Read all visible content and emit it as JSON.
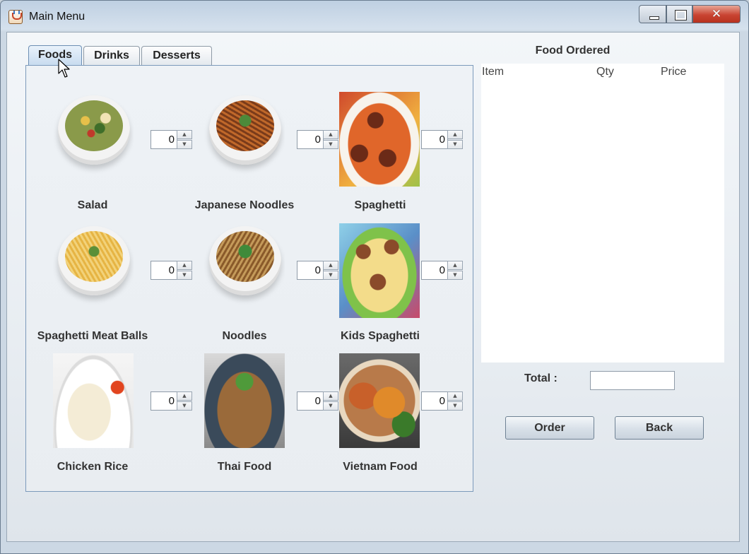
{
  "window": {
    "title": "Main Menu",
    "close_glyph": "✕"
  },
  "tabs": [
    {
      "label": "Foods",
      "active": true
    },
    {
      "label": "Drinks",
      "active": false
    },
    {
      "label": "Desserts",
      "active": false
    }
  ],
  "foods": [
    {
      "name": "Salad",
      "qty": "0",
      "icon": "salad-bowl-image"
    },
    {
      "name": "Japanese Noodles",
      "qty": "0",
      "icon": "japanese-noodles-bowl-image"
    },
    {
      "name": "Spaghetti",
      "qty": "0",
      "icon": "spaghetti-plate-photo"
    },
    {
      "name": "Spaghetti Meat Balls",
      "qty": "0",
      "icon": "spaghetti-meatballs-bowl-image"
    },
    {
      "name": "Noodles",
      "qty": "0",
      "icon": "noodles-bowl-image"
    },
    {
      "name": "Kids Spaghetti",
      "qty": "0",
      "icon": "kids-spaghetti-photo"
    },
    {
      "name": "Chicken Rice",
      "qty": "0",
      "icon": "chicken-rice-photo"
    },
    {
      "name": "Thai Food",
      "qty": "0",
      "icon": "thai-food-photo"
    },
    {
      "name": "Vietnam Food",
      "qty": "0",
      "icon": "vietnam-food-photo"
    }
  ],
  "order": {
    "heading": "Food Ordered",
    "columns": [
      "Item",
      "Qty",
      "Price"
    ],
    "total_label": "Total :",
    "total_value": ""
  },
  "buttons": {
    "order": "Order",
    "back": "Back"
  },
  "spinner": {
    "up": "▲",
    "down": "▼"
  }
}
